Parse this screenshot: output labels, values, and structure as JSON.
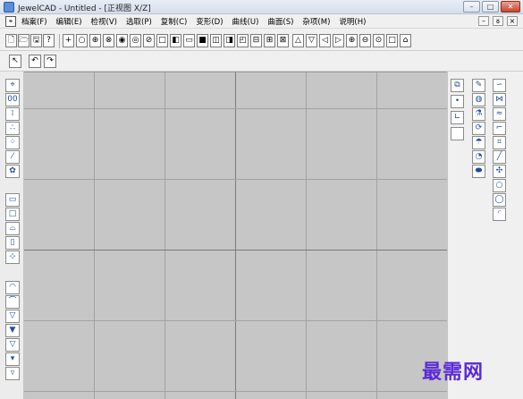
{
  "window": {
    "title": "JewelCAD - Untitled - [正视图 X/Z]",
    "buttons": {
      "minimize": "–",
      "maximize": "□",
      "close": "✕"
    }
  },
  "menubar": {
    "items": [
      "档案(F)",
      "编辑(E)",
      "检视(V)",
      "选取(P)",
      "复制(C)",
      "变形(D)",
      "曲线(U)",
      "曲面(S)",
      "杂项(M)",
      "说明(H)"
    ],
    "mdi": {
      "minimize": "–",
      "restore": "ᴕ",
      "close": "×"
    }
  },
  "toolbar1": {
    "file": [
      "🗋",
      "🗁",
      "🖫",
      "?"
    ],
    "view": [
      "+",
      "○",
      "⊕",
      "⊗",
      "◉",
      "◎",
      "⊘",
      "□",
      "◧",
      "▭",
      "■",
      "◫",
      "◨",
      "◰",
      "⊟",
      "⊞",
      "⊠"
    ],
    "nav": [
      "△",
      "▽",
      "◁",
      "▷",
      "⊕",
      "⊖",
      "⊙",
      "□",
      "⌂"
    ]
  },
  "toolbar2": {
    "items": [
      "↖",
      "↶",
      "↷"
    ]
  },
  "leftbar": {
    "top": [
      "⌖",
      "00",
      "⁞",
      "∴",
      "⁘",
      "⁄",
      "✿"
    ],
    "mid": [
      "▭",
      "□",
      "⌓",
      "▯",
      "⊹"
    ],
    "bottom": [
      "◠",
      "⌒",
      "▽",
      "▼",
      "▽",
      "▾",
      "▿"
    ]
  },
  "rightbar": {
    "col1": [
      "⧉",
      "•",
      "∟",
      " "
    ],
    "col2": [
      "✎",
      "◍",
      "⚗",
      "⟳",
      "☂",
      "◔",
      "⬬"
    ],
    "col3": [
      "∽",
      "⋈",
      "≈",
      "⌐",
      "⌗",
      "╱",
      "✣",
      "○",
      "◯",
      "◜"
    ]
  },
  "watermark": "最需网"
}
